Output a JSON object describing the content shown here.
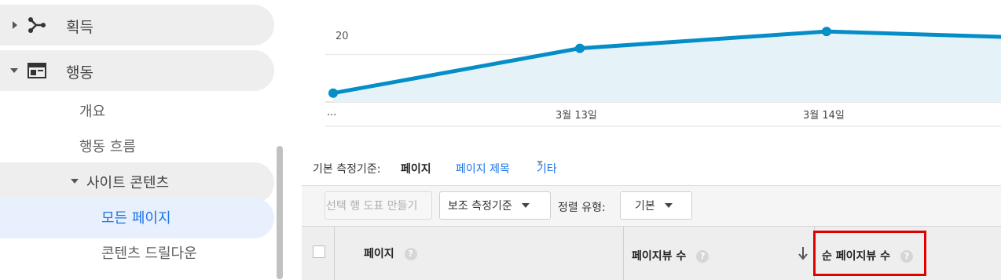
{
  "sidebar": {
    "acquisition_label": "획득",
    "behavior_label": "행동",
    "overview_label": "개요",
    "behavior_flow_label": "행동 흐름",
    "site_content_label": "사이트 콘텐츠",
    "all_pages_label": "모든 페이지",
    "content_drilldown_label": "콘텐츠 드릴다운"
  },
  "chart_data": {
    "type": "area",
    "x": [
      "...",
      "3월 13일",
      "3월 14일",
      ""
    ],
    "series": [
      {
        "values": [
          12,
          20,
          23,
          22
        ]
      }
    ],
    "ylim": [
      10,
      24
    ],
    "ytick_label": "20",
    "xtick_labels": [
      "...",
      "3월 13일",
      "3월 14일"
    ],
    "line_color": "#058dc7",
    "fill_color": "#e5f3f9",
    "grid": true
  },
  "dimension_bar": {
    "label": "기본 측정기준:",
    "active": "페이지",
    "page_title_link": "페이지 제목",
    "other_link": "기타"
  },
  "toolbar": {
    "make_chart_button": "선택 행 도표 만들기",
    "secondary_dimension_button": "보조 측정기준",
    "sort_type_label": "정렬 유형:",
    "sort_value": "기본"
  },
  "table_header": {
    "page_col": "페이지",
    "pageviews_col": "페이지뷰 수",
    "unique_pageviews_col": "순 페이지뷰 수",
    "help_glyph": "?"
  },
  "colors": {
    "accent": "#1a73e8",
    "highlight_border": "#e00000",
    "selected_bg": "#e8f0fe"
  }
}
